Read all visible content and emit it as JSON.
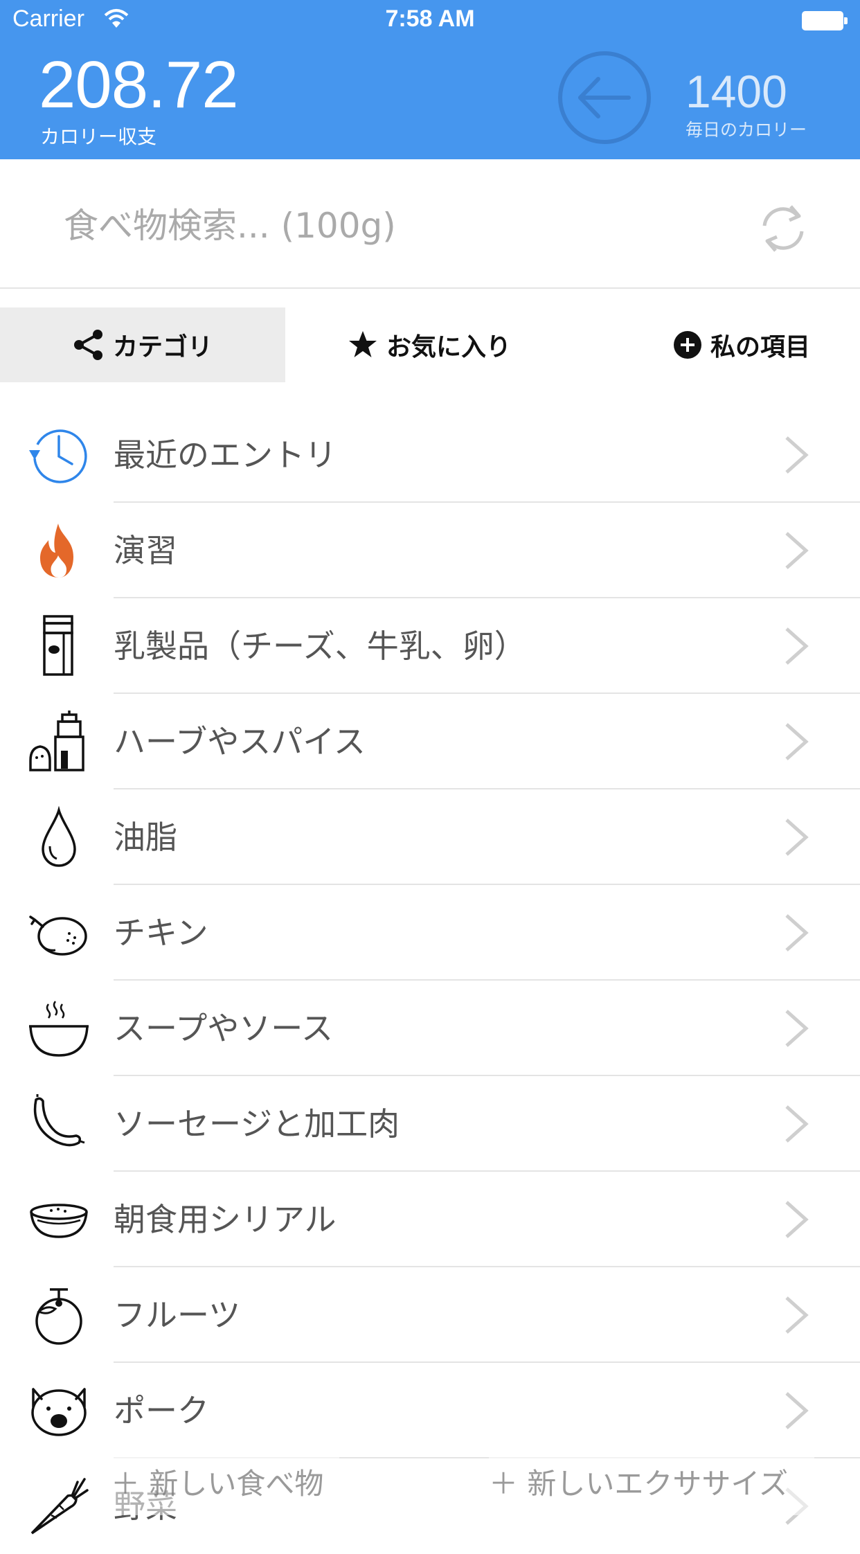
{
  "status_bar": {
    "carrier": "Carrier",
    "time": "7:58 AM"
  },
  "header": {
    "balance_value": "208.72",
    "balance_label": "カロリー収支",
    "daily_value": "1400",
    "daily_label": "毎日のカロリー"
  },
  "search": {
    "placeholder": "食べ物検索... (100g)"
  },
  "tabs": [
    {
      "label": "カテゴリ",
      "icon": "share-icon",
      "active": true
    },
    {
      "label": "お気に入り",
      "icon": "star-icon",
      "active": false
    },
    {
      "label": "私の項目",
      "icon": "plus-circle-icon",
      "active": false
    }
  ],
  "categories": [
    {
      "label": "最近のエントリ",
      "icon": "history-clock-icon"
    },
    {
      "label": "演習",
      "icon": "fire-icon"
    },
    {
      "label": "乳製品（チーズ、牛乳、卵）",
      "icon": "milk-carton-icon"
    },
    {
      "label": "ハーブやスパイス",
      "icon": "spice-grinder-icon"
    },
    {
      "label": "油脂",
      "icon": "oil-drop-icon"
    },
    {
      "label": "チキン",
      "icon": "roast-chicken-icon"
    },
    {
      "label": "スープやソース",
      "icon": "soup-bowl-icon"
    },
    {
      "label": "ソーセージと加工肉",
      "icon": "sausage-icon"
    },
    {
      "label": "朝食用シリアル",
      "icon": "cereal-bowl-icon"
    },
    {
      "label": "フルーツ",
      "icon": "fruit-icon"
    },
    {
      "label": "ポーク",
      "icon": "pig-icon"
    },
    {
      "label": "野菜",
      "icon": "carrot-icon"
    }
  ],
  "bottom_actions": {
    "new_food": "新しい食べ物",
    "new_exercise": "新しいエクササイズ"
  },
  "colors": {
    "header_bg": "#4696ee",
    "active_tab_bg": "#ececec",
    "history_icon": "#2f86ea",
    "fire_icon": "#e4682a"
  }
}
